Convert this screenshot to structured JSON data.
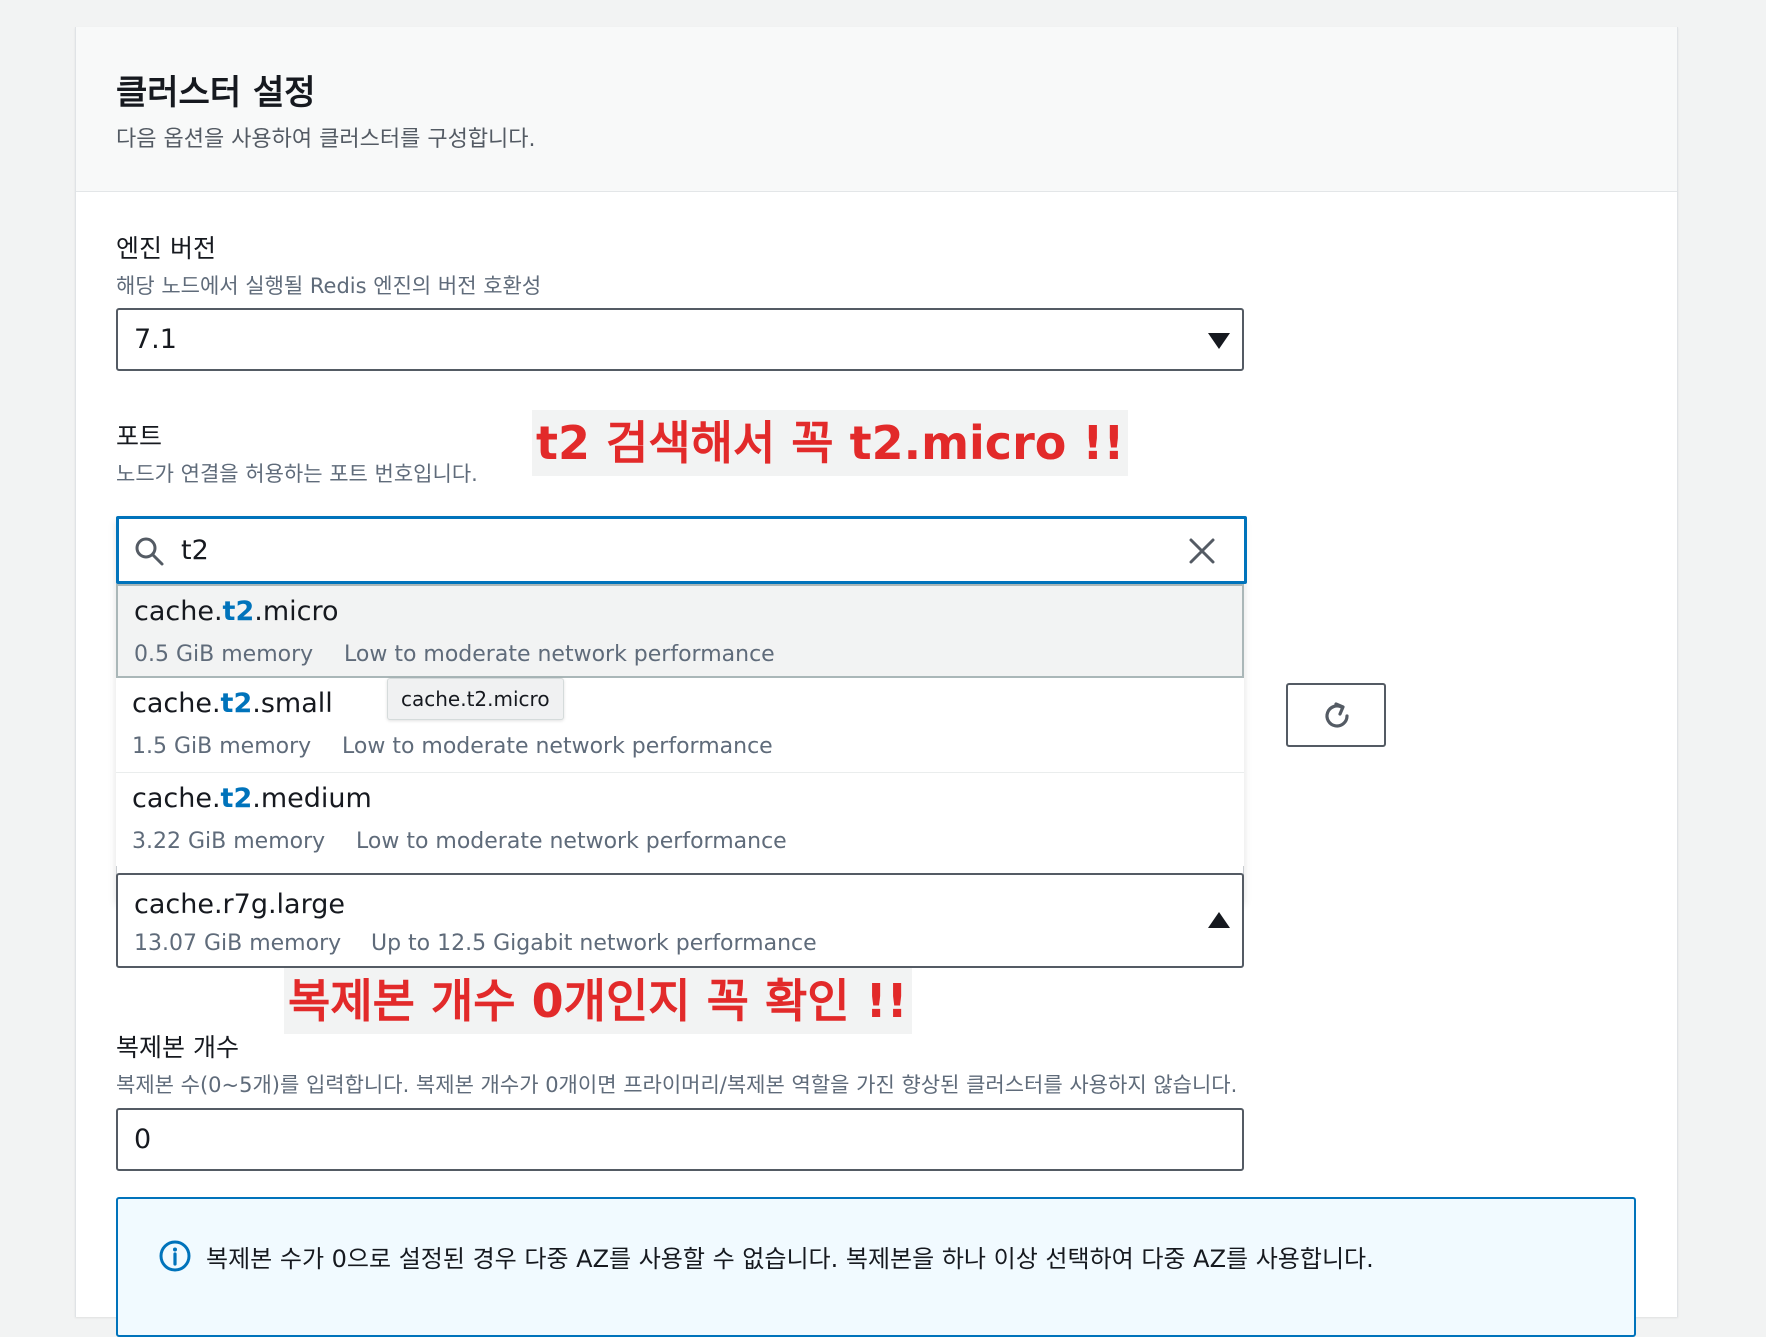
{
  "header": {
    "title": "클러스터 설정",
    "description": "다음 옵션을 사용하여 클러스터를 구성합니다."
  },
  "engine_version": {
    "label": "엔진 버전",
    "description": "해당 노드에서 실행될 Redis 엔진의 버전 호환성",
    "value": "7.1"
  },
  "port": {
    "label": "포트",
    "description": "노드가 연결을 허용하는 포트 번호입니다."
  },
  "node_type_search": {
    "value": "t2",
    "options": [
      {
        "prefix": "cache.",
        "match": "t2",
        "suffix": ".micro",
        "memory": "0.5 GiB memory",
        "network": "Low to moderate network performance"
      },
      {
        "prefix": "cache.",
        "match": "t2",
        "suffix": ".small",
        "memory": "1.5 GiB memory",
        "network": "Low to moderate network performance"
      },
      {
        "prefix": "cache.",
        "match": "t2",
        "suffix": ".medium",
        "memory": "3.22 GiB memory",
        "network": "Low to moderate network performance"
      }
    ],
    "tooltip": "cache.t2.micro"
  },
  "node_type": {
    "selected": "cache.r7g.large",
    "memory": "13.07 GiB memory",
    "network": "Up to 12.5 Gigabit network performance"
  },
  "replicas": {
    "label": "복제본 개수",
    "description": "복제본 수(0~5개)를 입력합니다. 복제본 개수가 0개이면 프라이머리/복제본 역할을 가진 향상된 클러스터를 사용하지 않습니다.",
    "value": "0"
  },
  "info": {
    "text": "복제본 수가 0으로 설정된 경우 다중 AZ를 사용할 수 없습니다. 복제본을 하나 이상 선택하여 다중 AZ를 사용합니다."
  },
  "annotations": {
    "search_hint": "t2 검색해서 꼭 t2.micro !!",
    "replica_hint": "복제본 개수 0개인지 꼭 확인 !!"
  },
  "colors": {
    "accent": "#0073bb",
    "annotation": "#e22a2a"
  }
}
